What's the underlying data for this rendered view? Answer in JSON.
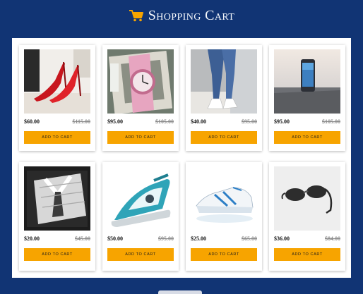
{
  "header": {
    "title": "Shopping Cart",
    "icon": "shopping-cart-icon"
  },
  "colors": {
    "background": "#113474",
    "accent": "#f7a400",
    "panel": "#ffffff"
  },
  "products": [
    {
      "image": "red-high-heel-shoes",
      "price": "$60.00",
      "old_price": "$115.00",
      "button": "ADD TO CART"
    },
    {
      "image": "pink-wristwatch-in-gift-box",
      "price": "$95.00",
      "old_price": "$105.00",
      "button": "ADD TO CART"
    },
    {
      "image": "jeans-and-white-sneakers",
      "price": "$40.00",
      "old_price": "$95.00",
      "button": "ADD TO CART"
    },
    {
      "image": "smartphone",
      "price": "$95.00",
      "old_price": "$105.00",
      "button": "ADD TO CART"
    },
    {
      "image": "shirt-in-box",
      "price": "$20.00",
      "old_price": "$45.00",
      "button": "ADD TO CART"
    },
    {
      "image": "steam-iron",
      "price": "$50.00",
      "old_price": "$95.00",
      "button": "ADD TO CART"
    },
    {
      "image": "running-sneaker",
      "price": "$25.00",
      "old_price": "$65.00",
      "button": "ADD TO CART"
    },
    {
      "image": "sunglasses",
      "price": "$36.00",
      "old_price": "$84.00",
      "button": "ADD TO CART"
    }
  ]
}
